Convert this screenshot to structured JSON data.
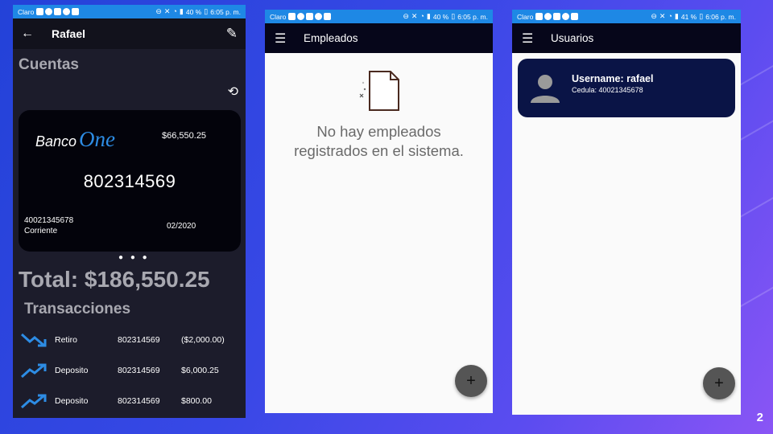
{
  "status_bars": {
    "phone1": {
      "carrier": "Claro",
      "battery": "40 %",
      "time": "6:05 p. m."
    },
    "phone2": {
      "carrier": "Claro",
      "battery": "40 %",
      "time": "6:05 p. m."
    },
    "phone3": {
      "carrier": "Claro",
      "battery": "41 %",
      "time": "6:06 p. m."
    }
  },
  "account_screen": {
    "appbar_title": "Rafael",
    "section_title": "Cuentas",
    "card": {
      "bank_name_1": "Banco",
      "bank_name_2": "One",
      "balance": "$66,550.25",
      "account_number": "802314569",
      "cedula": "40021345678",
      "account_type": "Corriente",
      "date": "02/2020"
    },
    "total": "Total: $186,550.25",
    "transactions_title": "Transacciones",
    "transactions": [
      {
        "type": "Retiro",
        "account": "802314569",
        "amount": "($2,000.00)",
        "direction": "down"
      },
      {
        "type": "Deposito",
        "account": "802314569",
        "amount": "$6,000.25",
        "direction": "up"
      },
      {
        "type": "Deposito",
        "account": "802314569",
        "amount": "$800.00",
        "direction": "up"
      }
    ]
  },
  "employees_screen": {
    "appbar_title": "Empleados",
    "empty_line1": "No hay empleados",
    "empty_line2": "registrados en el sistema.",
    "fab_label": "+"
  },
  "users_screen": {
    "appbar_title": "Usuarios",
    "user": {
      "username": "Username: rafael",
      "cedula": "Cedula: 40021345678"
    },
    "fab_label": "+"
  },
  "slide_number": "2",
  "colors": {
    "status_bar": "#1e88e5",
    "appbar_dark": "#06061a",
    "card_dark": "#03030b",
    "user_card": "#0a1446",
    "trend_icon": "#2d8ce4"
  }
}
